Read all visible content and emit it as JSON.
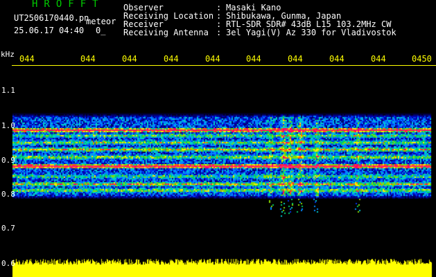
{
  "header": {
    "logo": "HROFFT",
    "filename": "UT2506170440.pn",
    "suffix": "meteor",
    "timestamp": "25.06.17 04:40",
    "counter": "0_"
  },
  "info": [
    {
      "label": "Observer",
      "value": "Masaki Kano"
    },
    {
      "label": "Receiving Location",
      "value": "Shibukawa, Gunma, Japan"
    },
    {
      "label": "Receiver",
      "value": "RTL-SDR SDR# 43dB L15 103.2MHz CW"
    },
    {
      "label": "Receiving Antenna",
      "value": "3el Yagi(V) Az 330 for Vladivostok"
    }
  ],
  "colon": ":",
  "axis": {
    "unit": "kHz",
    "x_ticks": [
      "044",
      "044",
      "044",
      "044",
      "044",
      "044",
      "044",
      "044",
      "044",
      "0450"
    ],
    "y_ticks": [
      "1.1",
      "1.0",
      "0.9",
      "0.8",
      "0.7",
      "0.6"
    ]
  },
  "colors": {
    "background": "#000000",
    "logo": "#00cc00",
    "tick_labels": "#ffff00",
    "noise_floor": "#ffff00",
    "band_line": "#ff3366"
  }
}
